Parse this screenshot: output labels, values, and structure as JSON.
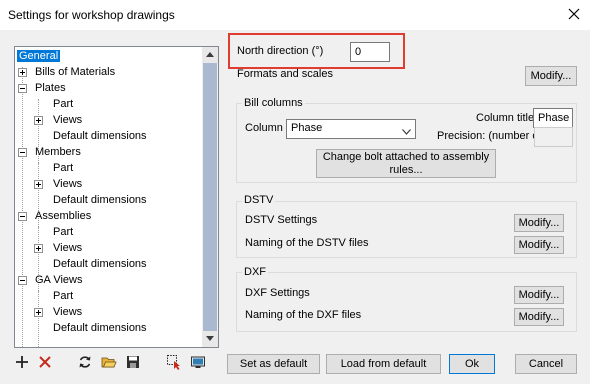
{
  "window": {
    "title": "Settings for workshop drawings"
  },
  "tree": {
    "items": [
      {
        "label": "General",
        "selected": true
      },
      {
        "label": "Bills of Materials"
      },
      {
        "label": "Plates"
      },
      {
        "label": "Part"
      },
      {
        "label": "Views"
      },
      {
        "label": "Default dimensions"
      },
      {
        "label": "Members"
      },
      {
        "label": "Part"
      },
      {
        "label": "Views"
      },
      {
        "label": "Default dimensions"
      },
      {
        "label": "Assemblies"
      },
      {
        "label": "Part"
      },
      {
        "label": "Views"
      },
      {
        "label": "Default dimensions"
      },
      {
        "label": "GA Views"
      },
      {
        "label": "Part"
      },
      {
        "label": "Views"
      },
      {
        "label": "Default dimensions"
      }
    ]
  },
  "north": {
    "label": "North direction (°)",
    "value": "0"
  },
  "formats": {
    "label": "Formats and scales",
    "modify": "Modify..."
  },
  "bill": {
    "group_title": "Bill columns",
    "column_label": "Column :",
    "column_value": "Phase",
    "column_title_label": "Column title:",
    "column_title_value": "Phase",
    "precision_label": "Precision: (number of",
    "change_bolt": "Change bolt attached to assembly\nrules..."
  },
  "dstv": {
    "group_title": "DSTV",
    "settings_label": "DSTV Settings",
    "naming_label": "Naming of the DSTV files",
    "modify": "Modify..."
  },
  "dxf": {
    "group_title": "DXF",
    "settings_label": "DXF Settings",
    "naming_label": "Naming of the DXF files",
    "modify": "Modify..."
  },
  "footer": {
    "set_default": "Set as default",
    "load_default": "Load from default",
    "ok": "Ok",
    "cancel": "Cancel"
  },
  "colors": {
    "highlight": "#e03c31",
    "selection": "#0078d7",
    "delete": "#c42b1c"
  }
}
